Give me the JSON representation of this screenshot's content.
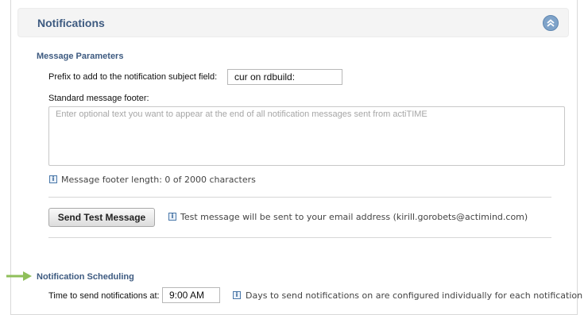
{
  "header": {
    "title": "Notifications",
    "collapse_icon": "double-chevron-up-icon"
  },
  "message_parameters": {
    "title": "Message Parameters",
    "prefix_label": "Prefix to add to the notification subject field:",
    "prefix_value": "cur on rdbuild:",
    "footer_label": "Standard message footer:",
    "footer_placeholder": "Enter optional text you want to appear at the end of all notification messages sent from actiTIME",
    "footer_length_hint": "Message footer length: 0 of 2000 characters"
  },
  "test_message": {
    "button_label": "Send Test Message",
    "hint": "Test message will be sent to your email address (kirill.gorobets@actimind.com)"
  },
  "scheduling": {
    "title": "Notification Scheduling",
    "time_label": "Time to send notifications at:",
    "time_value": "9:00 AM",
    "hint": "Days to send notifications on are configured individually for each notification"
  },
  "colors": {
    "accent_text": "#3d5a80",
    "pointer_arrow": "#8fbf5a",
    "header_bg": "#f4f4f4"
  }
}
